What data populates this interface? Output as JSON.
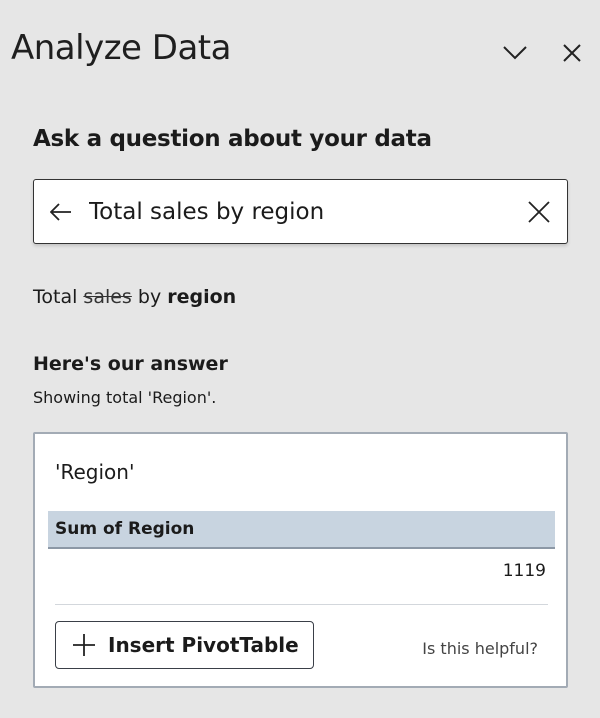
{
  "pane": {
    "title": "Analyze Data",
    "collapse_icon": "chevron-down-icon",
    "close_icon": "close-icon"
  },
  "question": {
    "heading": "Ask a question about your data",
    "value": "Total sales by region",
    "back_icon": "arrow-left-icon",
    "clear_icon": "close-icon"
  },
  "interpretation": {
    "word1": "Total",
    "struck": "sales",
    "word2": "by",
    "bold": "region"
  },
  "answer": {
    "heading": "Here's our answer",
    "subtitle": "Showing total 'Region'.",
    "card": {
      "title": "'Region'",
      "column_header": "Sum of Region",
      "value": "1119",
      "insert_label": "Insert PivotTable",
      "helpful": "Is this helpful?"
    }
  }
}
